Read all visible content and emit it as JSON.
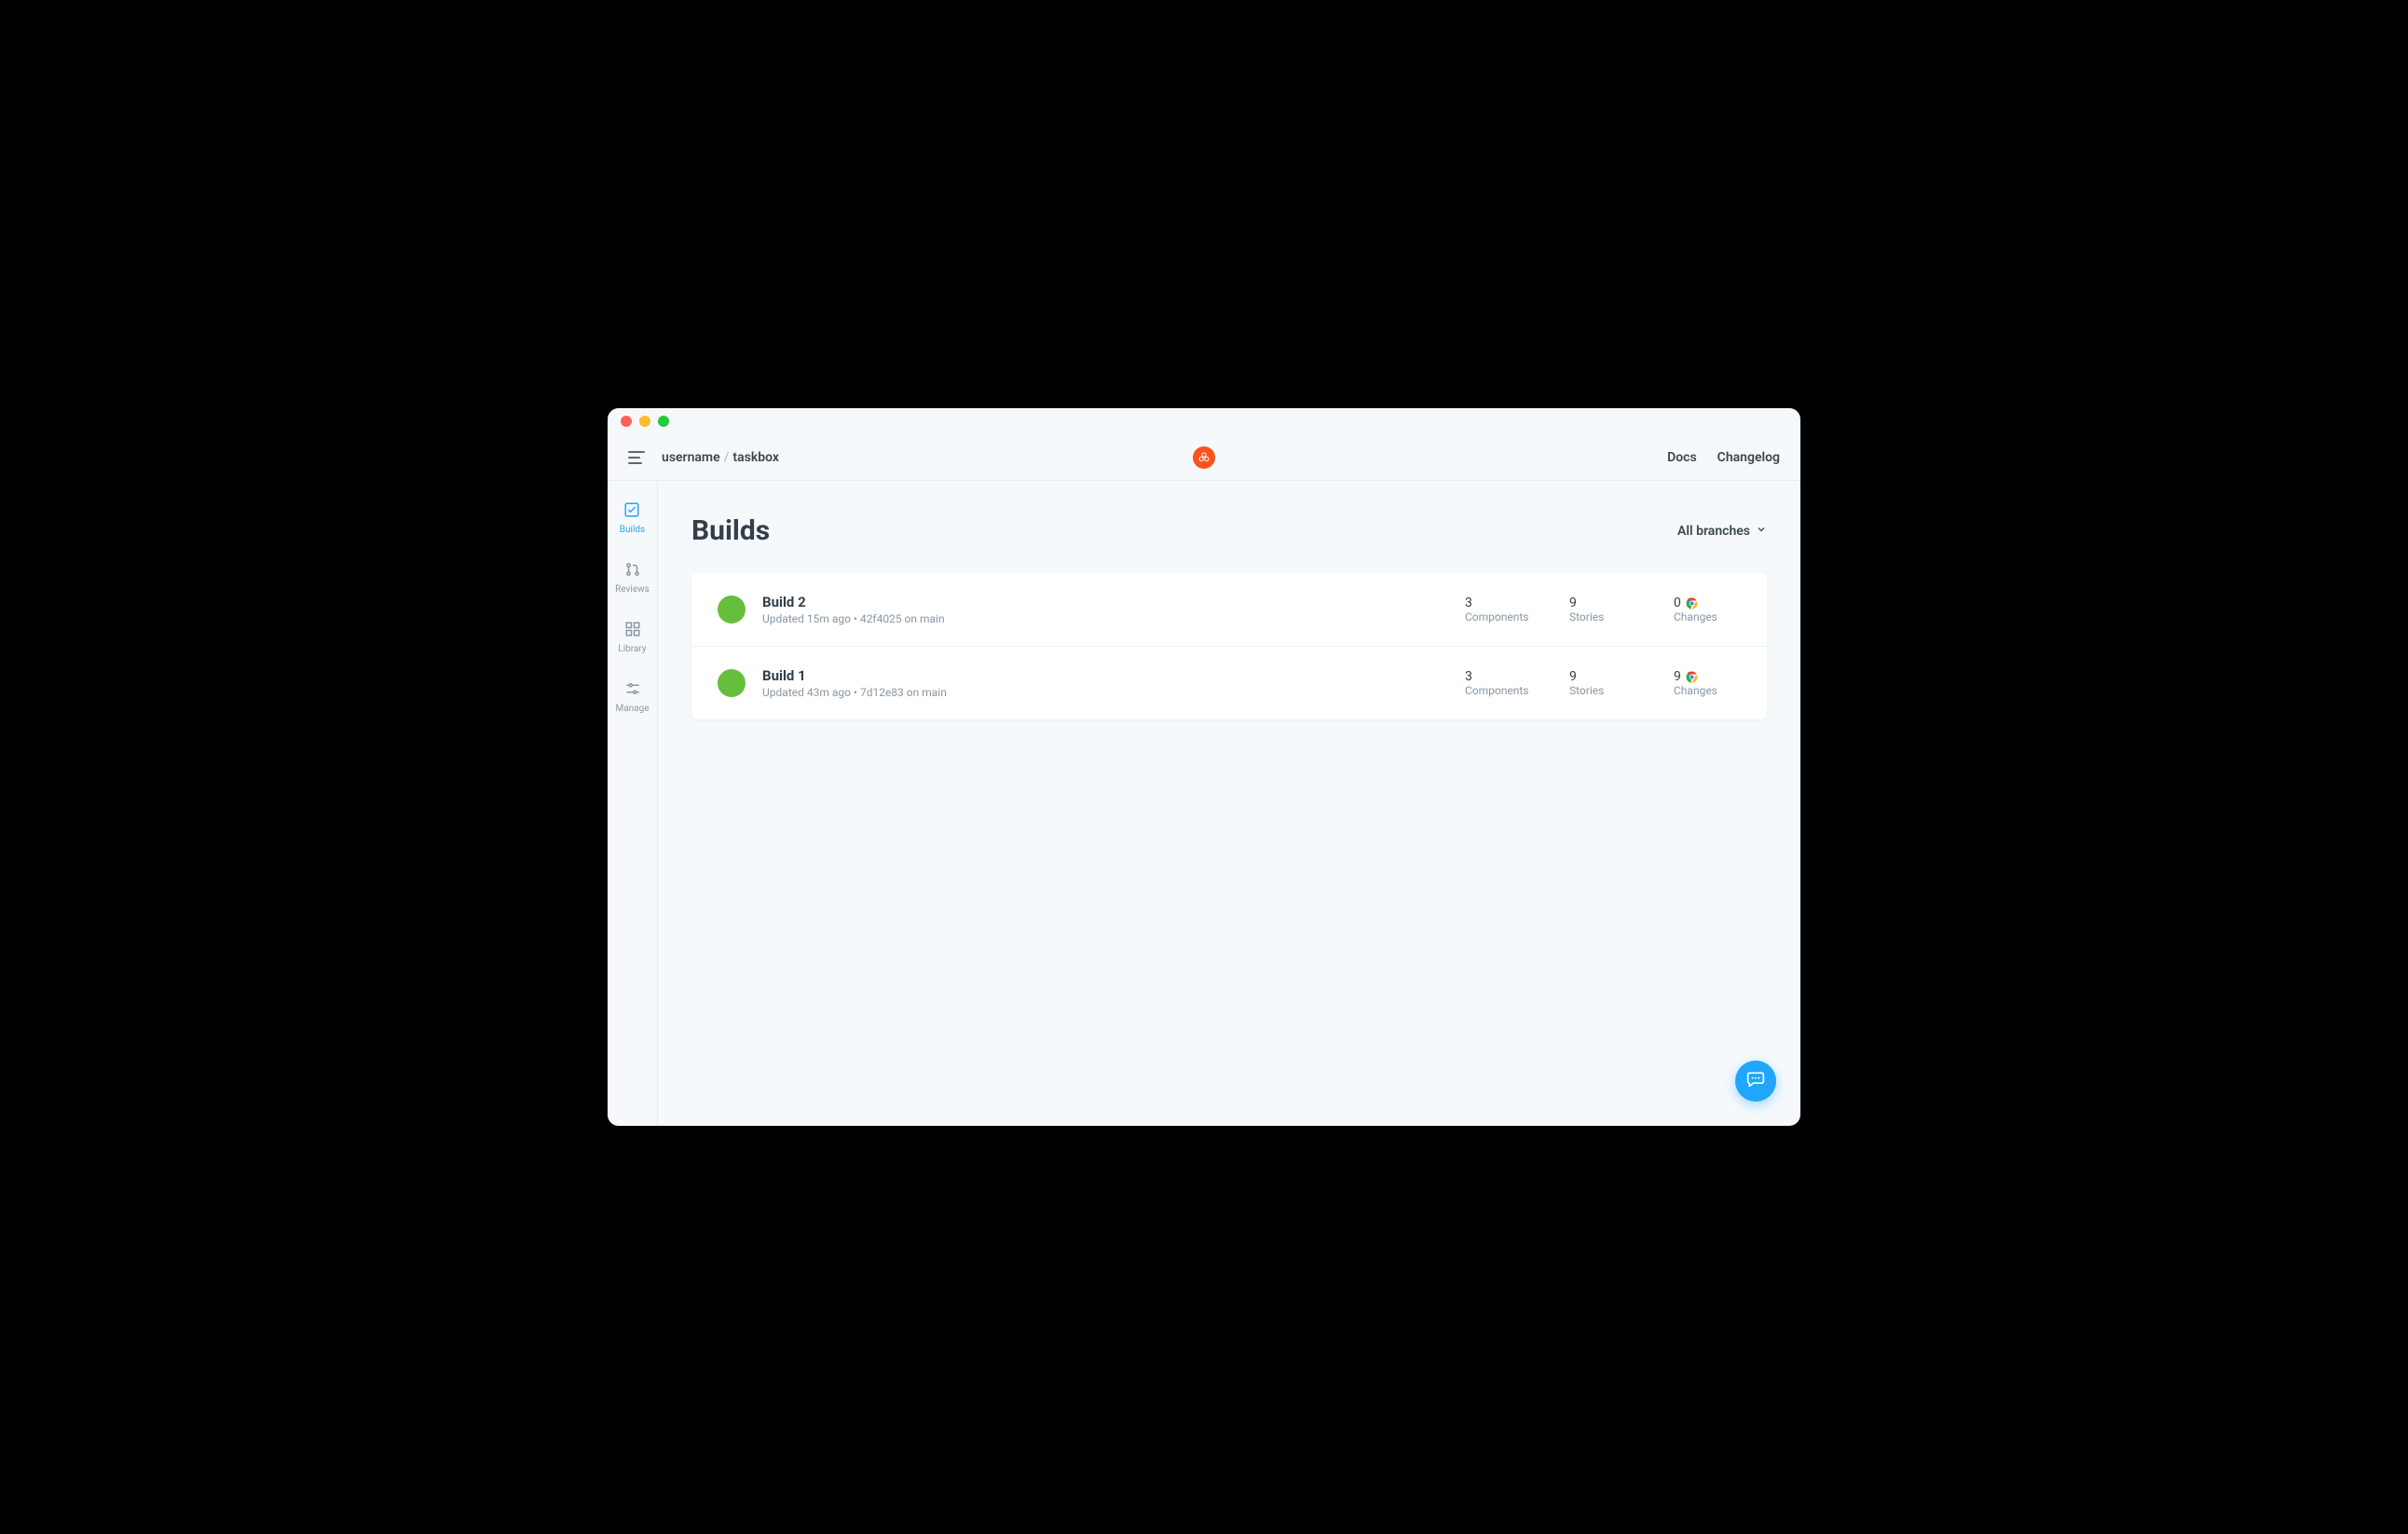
{
  "window": {
    "traffic_lights": [
      "close",
      "minimize",
      "maximize"
    ]
  },
  "topbar": {
    "breadcrumb_user": "username",
    "breadcrumb_repo": "taskbox",
    "links": {
      "docs": "Docs",
      "changelog": "Changelog"
    }
  },
  "sidebar": {
    "items": [
      {
        "id": "builds",
        "label": "Builds",
        "active": true,
        "icon": "checkbox-icon"
      },
      {
        "id": "reviews",
        "label": "Reviews",
        "active": false,
        "icon": "pull-request-icon"
      },
      {
        "id": "library",
        "label": "Library",
        "active": false,
        "icon": "grid-icon"
      },
      {
        "id": "manage",
        "label": "Manage",
        "active": false,
        "icon": "sliders-icon"
      }
    ]
  },
  "main": {
    "title": "Builds",
    "branch_filter": "All branches"
  },
  "builds": [
    {
      "name": "Build 2",
      "meta": "Updated 15m ago • 42f4025 on main",
      "status_color": "#66bf3c",
      "components": {
        "value": "3",
        "label": "Components"
      },
      "stories": {
        "value": "9",
        "label": "Stories"
      },
      "changes": {
        "value": "0",
        "label": "Changes"
      }
    },
    {
      "name": "Build 1",
      "meta": "Updated 43m ago • 7d12e83 on main",
      "status_color": "#66bf3c",
      "components": {
        "value": "3",
        "label": "Components"
      },
      "stories": {
        "value": "9",
        "label": "Stories"
      },
      "changes": {
        "value": "9",
        "label": "Changes"
      }
    }
  ],
  "chat": {
    "tooltip": "Chat"
  }
}
